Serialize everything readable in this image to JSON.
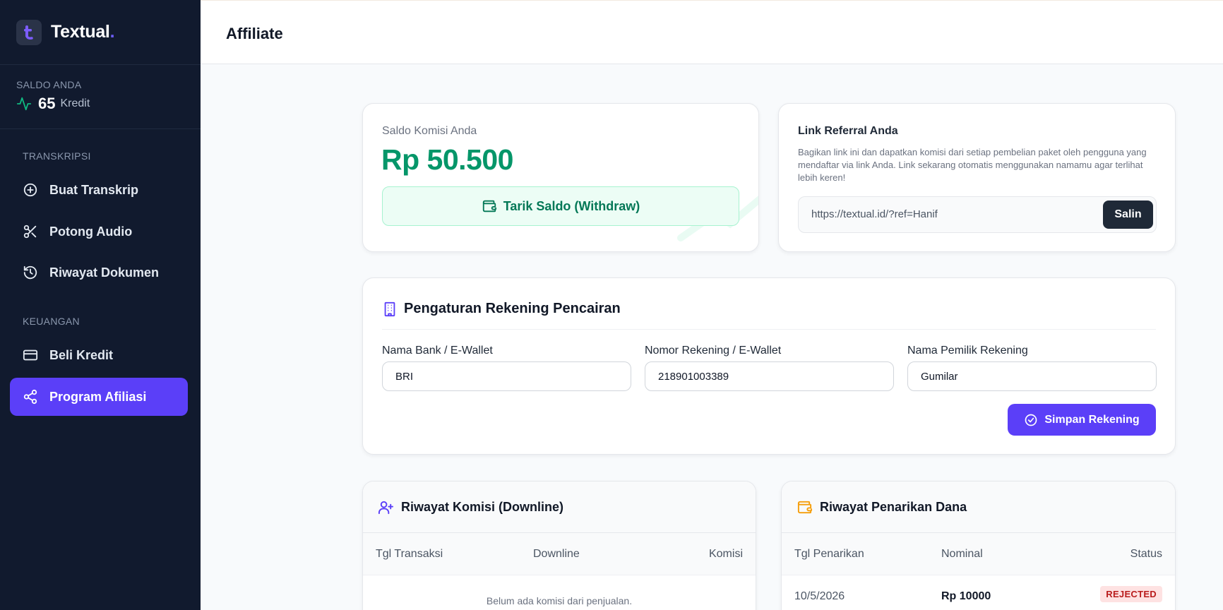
{
  "brand": {
    "name": "Textual",
    "dot": "."
  },
  "balance": {
    "label": "SALDO ANDA",
    "amount": "65",
    "unit": "Kredit"
  },
  "nav": {
    "section_transkripsi": "TRANSKRIPSI",
    "section_keuangan": "KEUANGAN",
    "items": [
      {
        "label": "Buat Transkrip",
        "icon": "plus-circle-icon"
      },
      {
        "label": "Potong Audio",
        "icon": "scissors-icon"
      },
      {
        "label": "Riwayat Dokumen",
        "icon": "history-icon"
      },
      {
        "label": "Beli Kredit",
        "icon": "credit-card-icon"
      },
      {
        "label": "Program Afiliasi",
        "icon": "share-icon",
        "active": true
      }
    ]
  },
  "header": {
    "title": "Affiliate"
  },
  "commission": {
    "label": "Saldo Komisi Anda",
    "amount": "Rp 50.500",
    "withdraw_label": "Tarik Saldo (Withdraw)"
  },
  "referral": {
    "title": "Link Referral Anda",
    "description": "Bagikan link ini dan dapatkan komisi dari setiap pembelian paket oleh pengguna yang mendaftar via link Anda. Link sekarang otomatis menggunakan namamu agar terlihat lebih keren!",
    "link": "https://textual.id/?ref=Hanif",
    "copy_label": "Salin"
  },
  "account": {
    "title": "Pengaturan Rekening Pencairan",
    "bank_label": "Nama Bank / E-Wallet",
    "bank_value": "BRI",
    "number_label": "Nomor Rekening / E-Wallet",
    "number_value": "218901003389",
    "owner_label": "Nama Pemilik Rekening",
    "owner_value": "Gumilar",
    "save_label": "Simpan Rekening"
  },
  "commission_history": {
    "title": "Riwayat Komisi (Downline)",
    "columns": [
      "Tgl Transaksi",
      "Downline",
      "Komisi"
    ],
    "empty": "Belum ada komisi dari penjualan."
  },
  "withdraw_history": {
    "title": "Riwayat Penarikan Dana",
    "columns": [
      "Tgl Penarikan",
      "Nominal",
      "Status"
    ],
    "rows": [
      {
        "date": "10/5/2026",
        "amount": "Rp 10000",
        "status": "REJECTED"
      }
    ]
  },
  "colors": {
    "sidebar": "#111a2e",
    "accent": "#5b3ff8",
    "success": "#059669",
    "danger": "#b91c1c"
  }
}
